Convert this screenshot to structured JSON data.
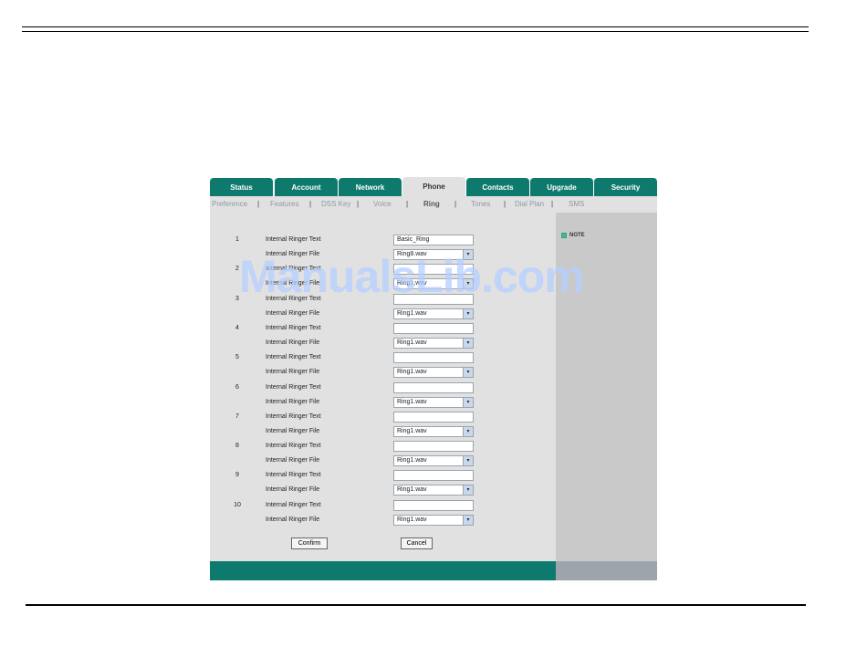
{
  "tabs": [
    {
      "label": "Status",
      "active": false
    },
    {
      "label": "Account",
      "active": false
    },
    {
      "label": "Network",
      "active": false
    },
    {
      "label": "Phone",
      "active": true
    },
    {
      "label": "Contacts",
      "active": false
    },
    {
      "label": "Upgrade",
      "active": false
    },
    {
      "label": "Security",
      "active": false
    }
  ],
  "subnav": [
    {
      "label": "Preference",
      "active": false
    },
    {
      "label": "Features",
      "active": false
    },
    {
      "label": "DSS Key",
      "active": false
    },
    {
      "label": "Voice",
      "active": false
    },
    {
      "label": "Ring",
      "active": true
    },
    {
      "label": "Tones",
      "active": false
    },
    {
      "label": "Dial Plan",
      "active": false
    },
    {
      "label": "SMS",
      "active": false
    }
  ],
  "separator": "|",
  "note_label": "NOTE",
  "rows": [
    {
      "num": "1",
      "text_label": "Internal Ringer Text",
      "text_value": "Basic_Ring",
      "file_label": "Internal Ringer File",
      "file_value": "Ring8.wav"
    },
    {
      "num": "2",
      "text_label": "Internal Ringer Text",
      "text_value": "",
      "file_label": "Internal Ringer File",
      "file_value": "Ring1.wav"
    },
    {
      "num": "3",
      "text_label": "Internal Ringer Text",
      "text_value": "",
      "file_label": "Internal Ringer File",
      "file_value": "Ring1.wav"
    },
    {
      "num": "4",
      "text_label": "Internal Ringer Text",
      "text_value": "",
      "file_label": "Internal Ringer File",
      "file_value": "Ring1.wav"
    },
    {
      "num": "5",
      "text_label": "Internal Ringer Text",
      "text_value": "",
      "file_label": "Internal Ringer File",
      "file_value": "Ring1.wav"
    },
    {
      "num": "6",
      "text_label": "Internal Ringer Text",
      "text_value": "",
      "file_label": "Internal Ringer File",
      "file_value": "Ring1.wav"
    },
    {
      "num": "7",
      "text_label": "Internal Ringer Text",
      "text_value": "",
      "file_label": "Internal Ringer File",
      "file_value": "Ring1.wav"
    },
    {
      "num": "8",
      "text_label": "Internal Ringer Text",
      "text_value": "",
      "file_label": "Internal Ringer File",
      "file_value": "Ring1.wav"
    },
    {
      "num": "9",
      "text_label": "Internal Ringer Text",
      "text_value": "",
      "file_label": "Internal Ringer File",
      "file_value": "Ring1.wav"
    },
    {
      "num": "10",
      "text_label": "Internal Ringer Text",
      "text_value": "",
      "file_label": "Internal Ringer File",
      "file_value": "Ring1.wav"
    }
  ],
  "buttons": {
    "confirm": "Confirm",
    "cancel": "Cancel"
  },
  "watermark": "ManualsLib.com",
  "colors": {
    "tab_bg": "#0e7a6e",
    "content_bg": "#e1e1e1",
    "panel_bg": "#c9c9c9",
    "footer_right": "#9da4ab"
  }
}
